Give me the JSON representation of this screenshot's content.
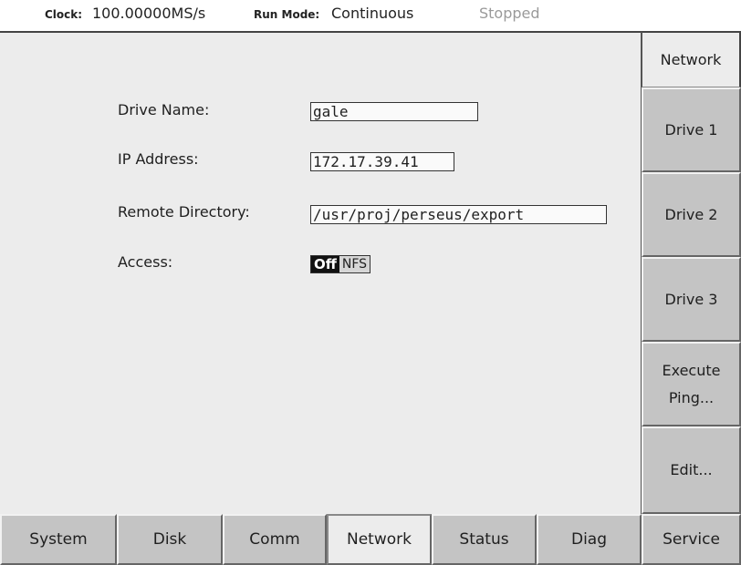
{
  "status": {
    "clock_label": "Clock:",
    "clock_value": "100.00000MS/s",
    "run_mode_label": "Run Mode:",
    "run_mode_value": "Continuous",
    "state": "Stopped"
  },
  "form": {
    "drive_name_label": "Drive Name:",
    "drive_name_value": "gale",
    "ip_label": "IP Address:",
    "ip_value": "172.17.39.41",
    "remote_dir_label": "Remote Directory:",
    "remote_dir_value": "/usr/proj/perseus/export",
    "access_label": "Access:",
    "access_options": [
      "Off",
      "NFS"
    ],
    "access_selected": "Off"
  },
  "side_menu": {
    "network": "Network",
    "drive1": "Drive 1",
    "drive2": "Drive 2",
    "drive3": "Drive 3",
    "execute_line1": "Execute",
    "execute_line2": "Ping...",
    "edit": "Edit...",
    "active": "Network"
  },
  "tabs": {
    "system": "System",
    "disk": "Disk",
    "comm": "Comm",
    "network": "Network",
    "status": "Status",
    "diag": "Diag",
    "service": "Service",
    "active": "Network"
  },
  "colors": {
    "panel_bg": "#ececec",
    "button_bg": "#c4c4c4",
    "toggle_on_bg": "#111111"
  }
}
